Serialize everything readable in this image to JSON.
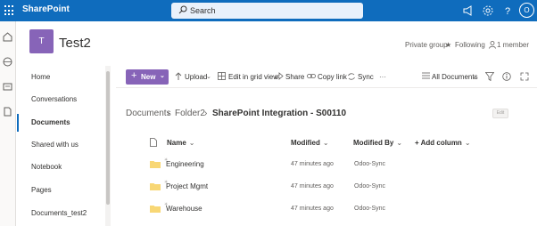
{
  "suite_bar": {
    "app_name": "SharePoint",
    "search_placeholder": "Search",
    "avatar_initial": "O"
  },
  "site": {
    "logo_letter": "T",
    "title": "Test2",
    "privacy": "Private group",
    "following": "Following",
    "members": "1 member"
  },
  "left_nav": {
    "items": [
      "Home",
      "Conversations",
      "Documents",
      "Shared with us",
      "Notebook",
      "Pages",
      "Documents_test2"
    ],
    "selected": "Documents"
  },
  "command_bar": {
    "new_label": "New",
    "upload_label": "Upload",
    "edit_grid_label": "Edit in grid view",
    "share_label": "Share",
    "copy_link_label": "Copy link",
    "sync_label": "Sync",
    "more_label": "···",
    "view_label": "All Documents"
  },
  "breadcrumb": {
    "items": [
      "Documents",
      "Folder2",
      "SharePoint Integration - S00110"
    ],
    "badge": "Edit"
  },
  "table": {
    "columns": {
      "name": "Name",
      "modified": "Modified",
      "modified_by": "Modified By",
      "add_column": "+ Add column"
    },
    "rows": [
      {
        "name": "Engineering",
        "modified": "47 minutes ago",
        "modified_by": "Odoo-Sync"
      },
      {
        "name": "Project Mgmt",
        "modified": "47 minutes ago",
        "modified_by": "Odoo-Sync"
      },
      {
        "name": "Warehouse",
        "modified": "47 minutes ago",
        "modified_by": "Odoo-Sync"
      }
    ]
  },
  "colors": {
    "suite_bar": "#0f6cbd",
    "accent_purple": "#8764b8",
    "folder_yellow": "#f8d775"
  }
}
